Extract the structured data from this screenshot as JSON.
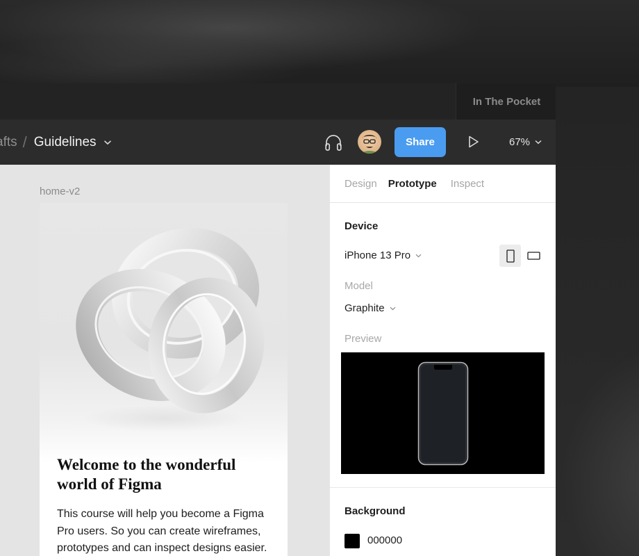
{
  "workspace": {
    "team_name": "In The Pocket"
  },
  "toolbar": {
    "breadcrumb_parent": "afts",
    "breadcrumb_separator": "/",
    "file_name": "Guidelines",
    "share_label": "Share",
    "zoom": "67%"
  },
  "canvas": {
    "frame_label": "home-v2",
    "headline": "Welcome to the wonderful world of Figma",
    "body": "This course will help you become a Figma Pro users. So you can create wireframes, prototypes and can inspect designs easier."
  },
  "panel": {
    "tabs": [
      {
        "label": "Design",
        "active": false
      },
      {
        "label": "Prototype",
        "active": true
      },
      {
        "label": "Inspect",
        "active": false
      }
    ],
    "device_heading": "Device",
    "device_value": "iPhone 13 Pro",
    "model_label": "Model",
    "model_value": "Graphite",
    "preview_label": "Preview",
    "background_heading": "Background",
    "background_value": "000000"
  },
  "colors": {
    "share_button": "#4a9cf0",
    "background_swatch": "#000000"
  },
  "icons": [
    "headphones-icon",
    "avatar",
    "play-icon",
    "chevron-down-icon",
    "portrait-orientation-icon",
    "landscape-orientation-icon"
  ]
}
